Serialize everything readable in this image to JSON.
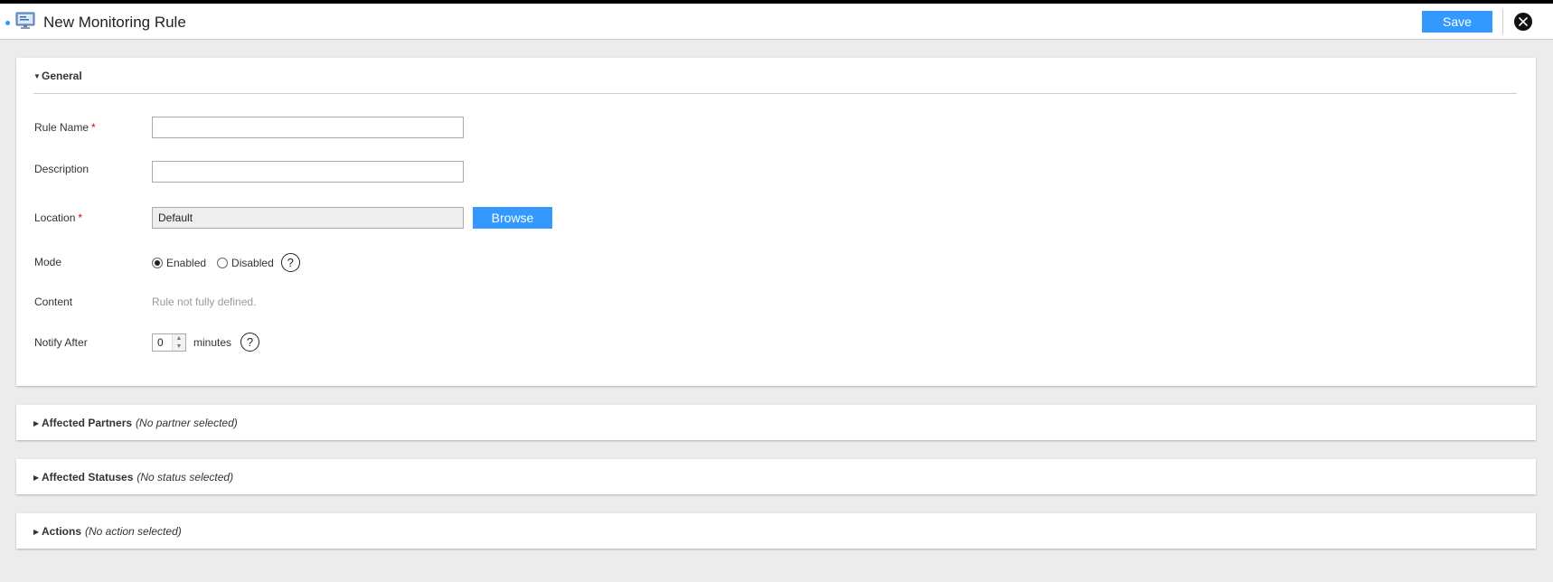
{
  "header": {
    "title": "New Monitoring Rule",
    "save_label": "Save",
    "app_icon": "monitor-icon",
    "close_icon": "close-icon"
  },
  "general": {
    "title": "General",
    "rule_name": {
      "label": "Rule Name",
      "required_mark": "*",
      "value": ""
    },
    "description": {
      "label": "Description",
      "value": ""
    },
    "location": {
      "label": "Location",
      "required_mark": "*",
      "value": "Default",
      "browse_label": "Browse"
    },
    "mode": {
      "label": "Mode",
      "options": [
        "Enabled",
        "Disabled"
      ],
      "selected": "Enabled",
      "help_glyph": "?"
    },
    "content": {
      "label": "Content",
      "value": "Rule not fully defined."
    },
    "notify_after": {
      "label": "Notify After",
      "value": "0",
      "unit": "minutes",
      "help_glyph": "?"
    }
  },
  "sections": {
    "partners": {
      "title": "Affected Partners",
      "note": "(No partner selected)"
    },
    "statuses": {
      "title": "Affected Statuses",
      "note": "(No status selected)"
    },
    "actions": {
      "title": "Actions",
      "note": "(No action selected)"
    }
  },
  "colors": {
    "accent": "#3399ff",
    "required": "#dd0000",
    "background": "#ececec"
  }
}
